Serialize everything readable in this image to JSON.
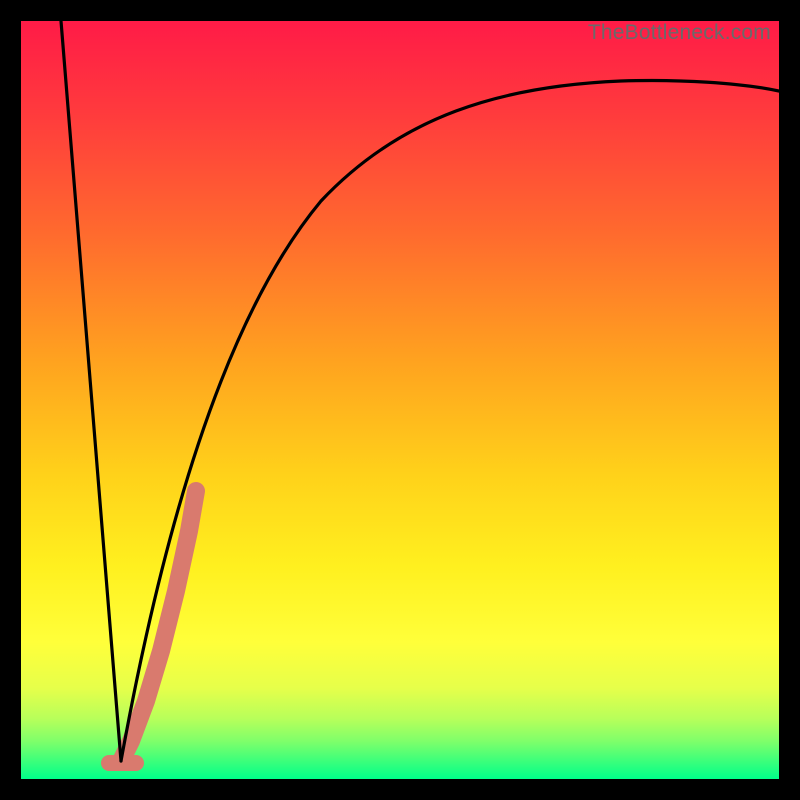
{
  "watermark": "TheBottleneck.com",
  "chart_data": {
    "type": "line",
    "title": "",
    "xlabel": "",
    "ylabel": "",
    "xlim": [
      0,
      100
    ],
    "ylim": [
      0,
      100
    ],
    "series": [
      {
        "name": "left-falling-segment",
        "x": [
          5,
          13
        ],
        "y": [
          100,
          2
        ]
      },
      {
        "name": "rising-asymptotic-curve",
        "x": [
          13,
          16,
          20,
          25,
          30,
          35,
          40,
          45,
          50,
          55,
          60,
          65,
          70,
          75,
          80,
          85,
          90,
          95,
          100
        ],
        "y": [
          2,
          18,
          35,
          50,
          60,
          67,
          72,
          76,
          79,
          81.5,
          83.5,
          85,
          86.2,
          87.2,
          88,
          88.7,
          89.3,
          89.7,
          90
        ]
      },
      {
        "name": "salmon-highlight-band",
        "x": [
          13.5,
          22
        ],
        "y": [
          3,
          40
        ]
      }
    ],
    "colors": {
      "curve": "#000000",
      "highlight": "#d97a6e"
    }
  }
}
